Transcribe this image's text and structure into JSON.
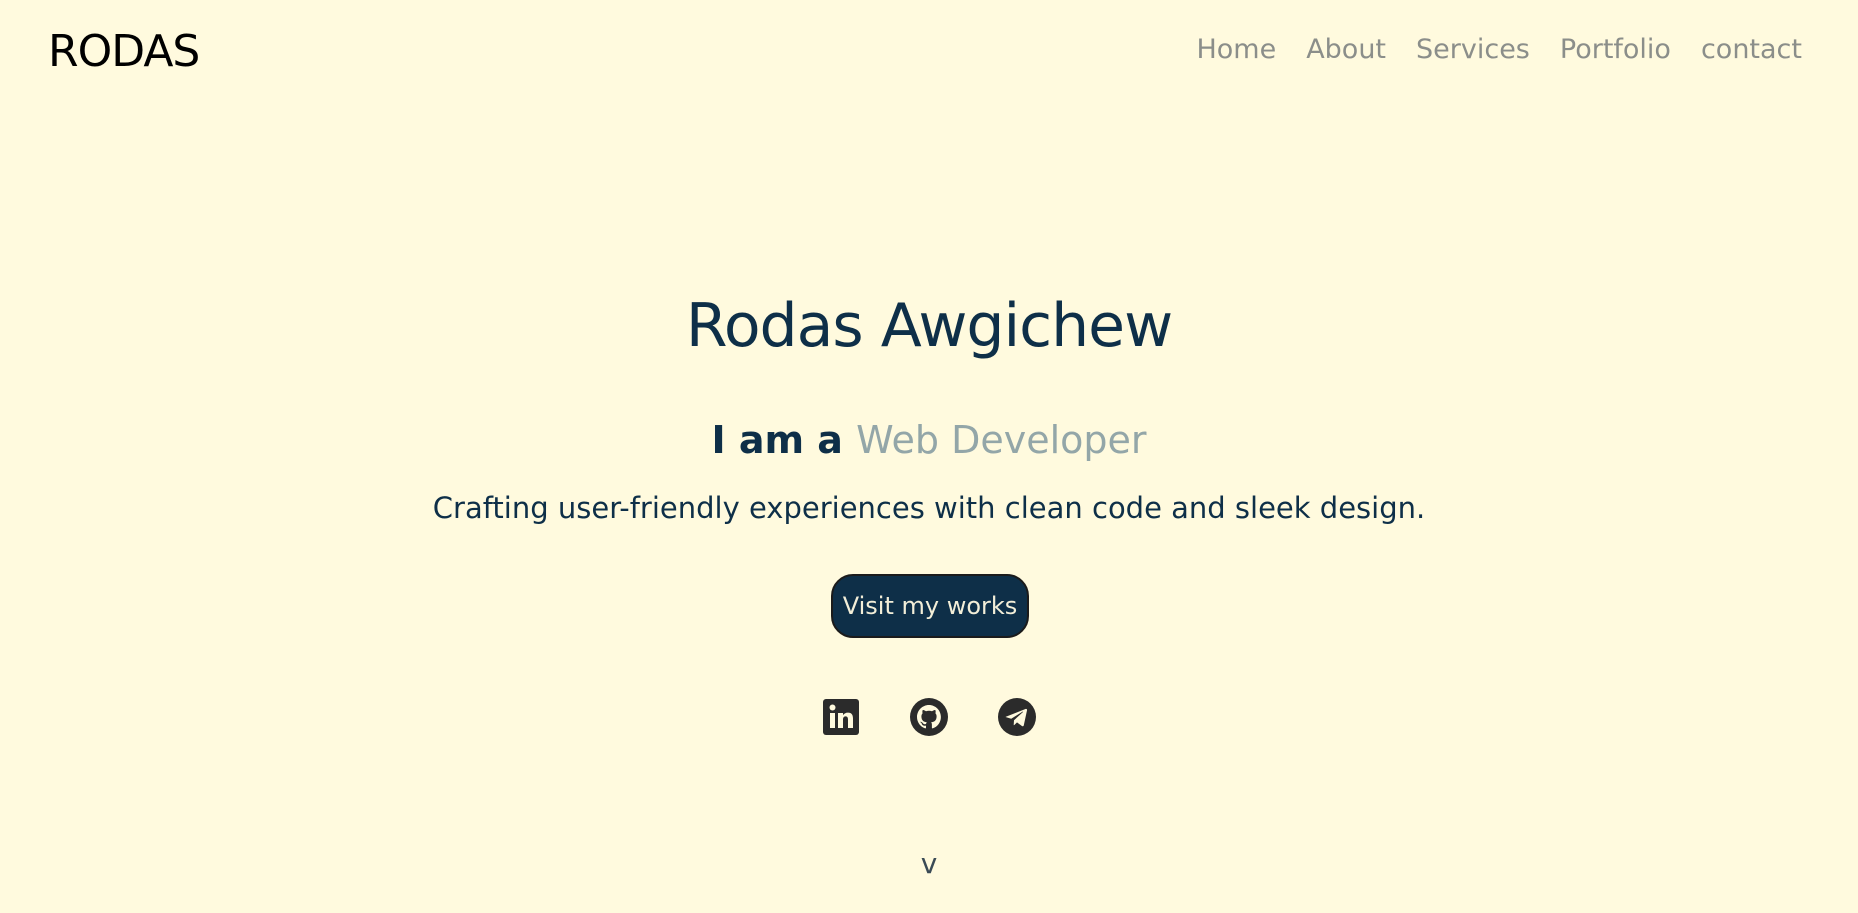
{
  "header": {
    "logo": "RODAS",
    "nav": [
      {
        "label": "Home"
      },
      {
        "label": "About"
      },
      {
        "label": "Services"
      },
      {
        "label": "Portfolio"
      },
      {
        "label": "contact"
      }
    ]
  },
  "hero": {
    "name": "Rodas Awgichew",
    "role_prefix": "I am a ",
    "role_highlight": "Web Developer",
    "tagline": "Crafting user-friendly experiences with clean code and sleek design.",
    "cta_label": "Visit my works"
  },
  "socials": [
    {
      "icon": "linkedin-icon"
    },
    {
      "icon": "github-icon"
    },
    {
      "icon": "telegram-icon"
    }
  ],
  "scroll_indicator": "v",
  "colors": {
    "background": "#fffade",
    "primary": "#0e2f48",
    "accent": "#93a6a8",
    "nav_text": "#8b8e8a",
    "icon": "#2b2b2b"
  }
}
